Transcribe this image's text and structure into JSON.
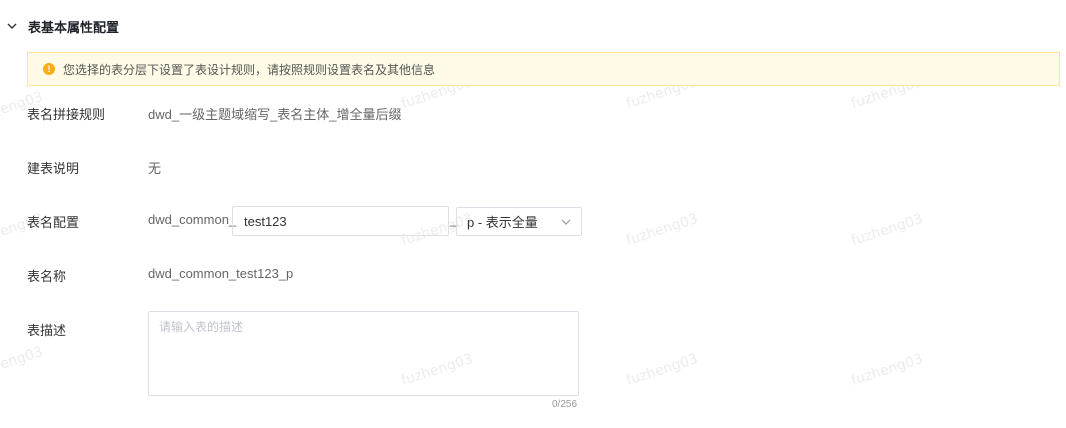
{
  "section": {
    "title": "表基本属性配置",
    "toggle_icon": "chevron-down-icon"
  },
  "alert": {
    "icon": "warning-icon",
    "icon_glyph": "!",
    "text": "您选择的表分层下设置了表设计规则，请按照规则设置表名及其他信息",
    "color": "#faad14"
  },
  "fields": {
    "rule": {
      "label": "表名拼接规则",
      "value": "dwd_一级主题域缩写_表名主体_增全量后缀"
    },
    "build_note": {
      "label": "建表说明",
      "value": "无"
    },
    "name_config": {
      "label": "表名配置",
      "prefix": "dwd_common_",
      "input_value": "test123",
      "separator": "_",
      "suffix_selected": "p - 表示全量"
    },
    "table_name": {
      "label": "表名称",
      "value": "dwd_common_test123_p"
    },
    "description": {
      "label": "表描述",
      "placeholder": "请输入表的描述",
      "counter": "0/256"
    }
  },
  "watermark": "fuzheng03"
}
